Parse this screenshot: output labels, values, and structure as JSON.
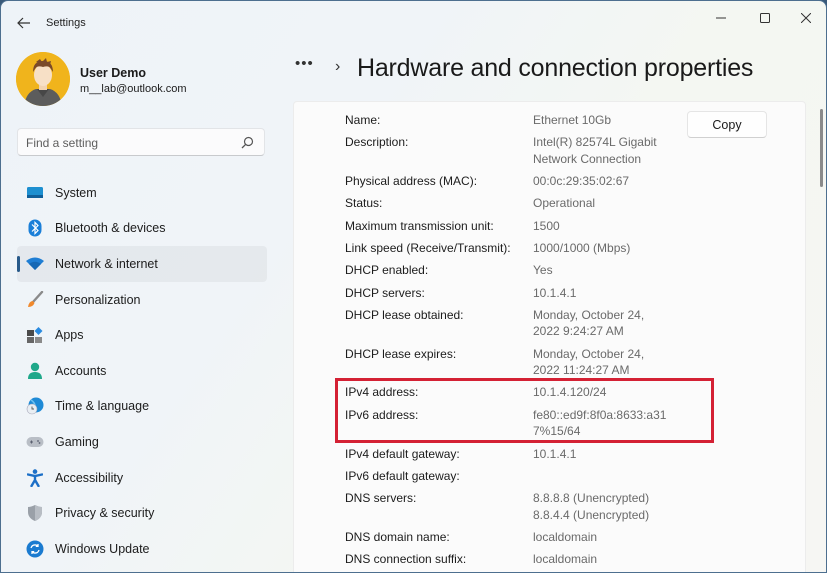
{
  "window": {
    "title": "Settings",
    "controls": {
      "minimize": "–",
      "maximize": "□",
      "close": "✕"
    }
  },
  "profile": {
    "name": "User Demo",
    "email": "m__lab@outlook.com"
  },
  "search": {
    "placeholder": "Find a setting",
    "value": ""
  },
  "sidebar": {
    "items": [
      {
        "label": "System",
        "icon": "system-icon",
        "selected": false
      },
      {
        "label": "Bluetooth & devices",
        "icon": "bluetooth-icon",
        "selected": false
      },
      {
        "label": "Network & internet",
        "icon": "wifi-icon",
        "selected": true
      },
      {
        "label": "Personalization",
        "icon": "brush-icon",
        "selected": false
      },
      {
        "label": "Apps",
        "icon": "apps-icon",
        "selected": false
      },
      {
        "label": "Accounts",
        "icon": "person-icon",
        "selected": false
      },
      {
        "label": "Time & language",
        "icon": "globe-clock-icon",
        "selected": false
      },
      {
        "label": "Gaming",
        "icon": "gamepad-icon",
        "selected": false
      },
      {
        "label": "Accessibility",
        "icon": "accessibility-icon",
        "selected": false
      },
      {
        "label": "Privacy & security",
        "icon": "shield-icon",
        "selected": false
      },
      {
        "label": "Windows Update",
        "icon": "update-icon",
        "selected": false
      }
    ]
  },
  "header": {
    "more": "•••",
    "chevron": "›",
    "title": "Hardware and connection properties"
  },
  "properties": {
    "copy_label": "Copy",
    "rows": [
      {
        "label": "Name:",
        "value": [
          "Ethernet 10Gb"
        ]
      },
      {
        "label": "Description:",
        "value": [
          "Intel(R) 82574L Gigabit",
          "Network Connection"
        ]
      },
      {
        "label": "Physical address (MAC):",
        "value": [
          "00:0c:29:35:02:67"
        ]
      },
      {
        "label": "Status:",
        "value": [
          "Operational"
        ]
      },
      {
        "label": "Maximum transmission unit:",
        "value": [
          "1500"
        ]
      },
      {
        "label": "Link speed (Receive/Transmit):",
        "value": [
          "1000/1000 (Mbps)"
        ]
      },
      {
        "label": "DHCP enabled:",
        "value": [
          "Yes"
        ]
      },
      {
        "label": "DHCP servers:",
        "value": [
          "10.1.4.1"
        ]
      },
      {
        "label": "DHCP lease obtained:",
        "value": [
          "Monday, October 24,",
          "2022 9:24:27 AM"
        ]
      },
      {
        "label": "DHCP lease expires:",
        "value": [
          "Monday, October 24,",
          "2022 11:24:27 AM"
        ]
      },
      {
        "label": "IPv4 address:",
        "value": [
          "10.1.4.120/24"
        ]
      },
      {
        "label": "IPv6 address:",
        "value": [
          "fe80::ed9f:8f0a:8633:a31",
          "7%15/64"
        ]
      },
      {
        "label": "IPv4 default gateway:",
        "value": [
          "10.1.4.1"
        ]
      },
      {
        "label": "IPv6 default gateway:",
        "value": []
      },
      {
        "label": "DNS servers:",
        "value": [
          "8.8.8.8 (Unencrypted)",
          "8.8.4.4 (Unencrypted)"
        ]
      },
      {
        "label": "DNS domain name:",
        "value": [
          "localdomain"
        ]
      },
      {
        "label": "DNS connection suffix:",
        "value": [
          "localdomain"
        ]
      }
    ]
  },
  "annotation": {
    "highlight_color": "#d42134",
    "highlighted_rows": [
      "IPv4 address:",
      "IPv6 address:"
    ]
  },
  "colors": {
    "accent": "#285a8a",
    "avatar_bg": "#f0b41c"
  }
}
